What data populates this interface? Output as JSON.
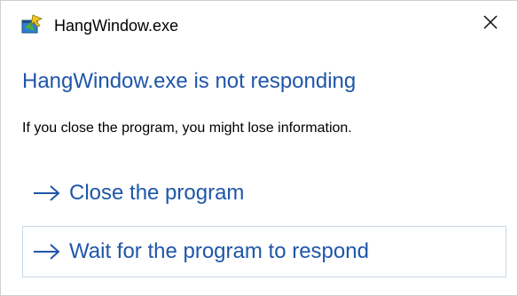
{
  "window": {
    "title": "HangWindow.exe",
    "app_icon": "hang-window-app-icon",
    "close_icon": "close-icon"
  },
  "main": {
    "heading": "HangWindow.exe is not responding",
    "message": "If you close the program, you might lose information."
  },
  "commands": [
    {
      "label": "Close the program",
      "icon": "right-arrow-icon"
    },
    {
      "label": "Wait for the program to respond",
      "icon": "right-arrow-icon"
    }
  ],
  "colors": {
    "accent": "#1f56a8",
    "focus_border": "#c8d8e8"
  }
}
